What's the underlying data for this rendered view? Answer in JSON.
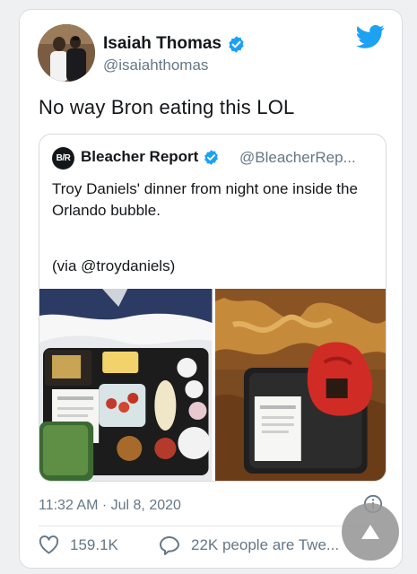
{
  "colors": {
    "twitter_blue": "#1da1f2",
    "text_primary": "#14171a",
    "text_secondary": "#657786",
    "border": "#d4dadf"
  },
  "author": {
    "display_name": "Isaiah Thomas",
    "handle": "@isaiahthomas",
    "verified": true
  },
  "tweet": {
    "text": "No way Bron eating this LOL",
    "timestamp": "11:32 AM · Jul 8, 2020"
  },
  "quoted": {
    "logo_text": "B/R",
    "display_name": "Bleacher Report",
    "handle": "@BleacherRep...",
    "verified": true,
    "text": "Troy Daniels' dinner from night one inside the Orlando bubble.",
    "credit": "(via @troydaniels)"
  },
  "stats": {
    "likes": "159.1K",
    "replies": "22K people are Twe..."
  },
  "icons": {
    "brand": "twitter-bird-icon",
    "verified": "verified-badge-icon",
    "info": "info-icon",
    "like": "heart-icon",
    "reply": "speech-bubble-icon",
    "scroll": "arrow-up-icon"
  }
}
